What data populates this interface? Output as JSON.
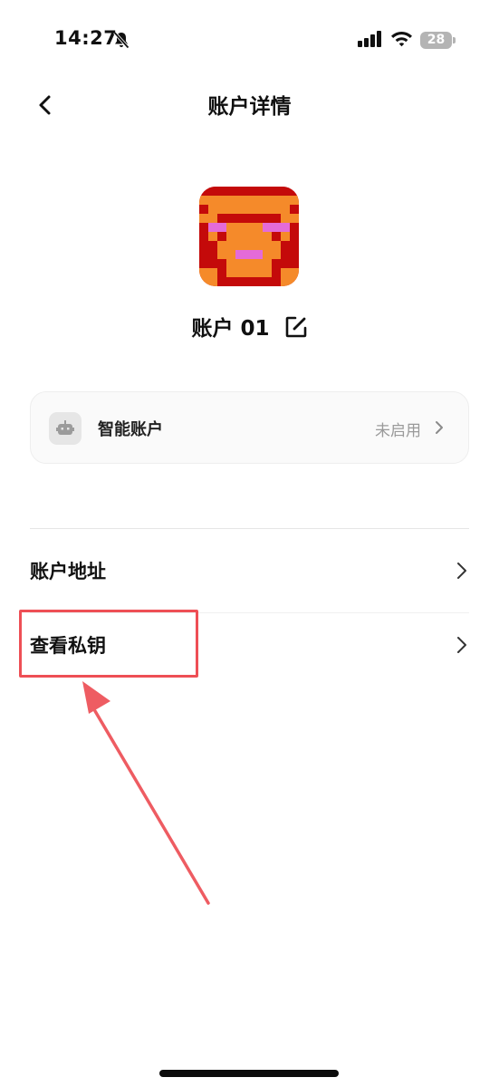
{
  "status_bar": {
    "time": "14:27",
    "battery": "28",
    "icons": [
      "bell-slash-icon",
      "signal-icon",
      "wifi-icon",
      "battery-icon"
    ]
  },
  "nav": {
    "title": "账户详情",
    "back_icon": "chevron-left-icon"
  },
  "account": {
    "name": "账户 01",
    "edit_icon": "edit-icon",
    "avatar_colors": {
      "red": "#c40a0a",
      "orange": "#f58a2a",
      "pink": "#e46bd8"
    }
  },
  "smart_account": {
    "label": "智能账户",
    "status": "未启用",
    "icon": "robot-icon"
  },
  "rows": [
    {
      "label": "账户地址"
    },
    {
      "label": "查看私钥"
    }
  ],
  "annotation": {
    "highlight_color": "#ee4f55"
  }
}
